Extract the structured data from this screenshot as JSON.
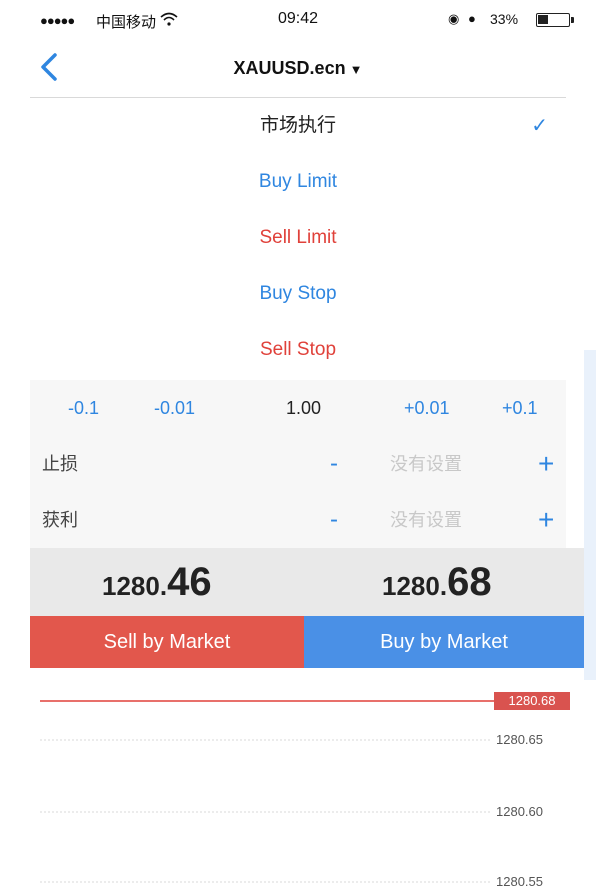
{
  "status_bar": {
    "signal_dots": "●●●●●",
    "carrier": "中国移动",
    "time": "09:42",
    "battery_percent": "33%"
  },
  "nav": {
    "title": "XAUUSD.ecn",
    "caret": "▼"
  },
  "order_types": [
    {
      "label": "市场执行",
      "kind": "sel",
      "selected": true
    },
    {
      "label": "Buy Limit",
      "kind": "buy",
      "selected": false
    },
    {
      "label": "Sell Limit",
      "kind": "sell",
      "selected": false
    },
    {
      "label": "Buy Stop",
      "kind": "buy",
      "selected": false
    },
    {
      "label": "Sell Stop",
      "kind": "sell",
      "selected": false
    }
  ],
  "check_mark": "✓",
  "volume": {
    "minus_big": "-0.1",
    "minus_small": "-0.01",
    "value": "1.00",
    "plus_small": "+0.01",
    "plus_big": "+0.1"
  },
  "stop_loss": {
    "label": "止损",
    "minus": "-",
    "placeholder": "没有设置",
    "plus": "+"
  },
  "take_profit": {
    "label": "获利",
    "minus": "-",
    "placeholder": "没有设置",
    "plus": "+"
  },
  "prices": {
    "bid_prefix": "1280.",
    "bid_suffix": "46",
    "ask_prefix": "1280.",
    "ask_suffix": "68"
  },
  "actions": {
    "sell_label": "Sell by Market",
    "buy_label": "Buy by Market"
  },
  "chart": {
    "current_price": "1280.68",
    "ticks": [
      "1280.65",
      "1280.60",
      "1280.55"
    ]
  },
  "colors": {
    "blue": "#2f86e0",
    "red": "#e0413a",
    "sell_button": "#e2574c",
    "buy_button": "#4a90e6"
  }
}
